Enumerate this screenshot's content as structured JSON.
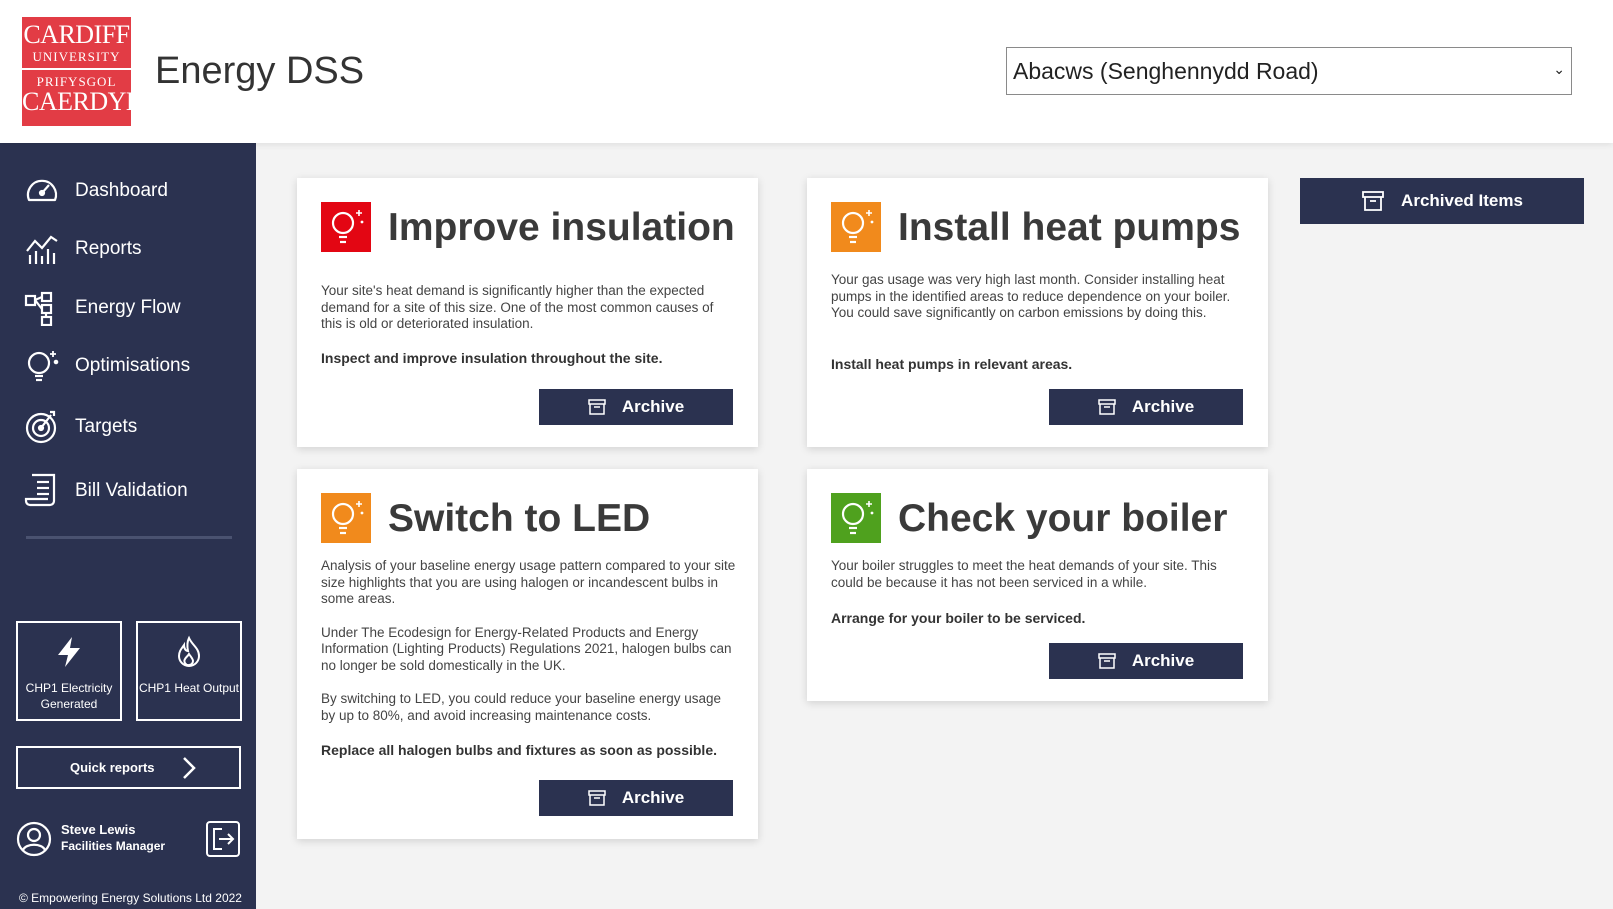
{
  "header": {
    "logo": {
      "line1": "CARDIFF",
      "line2": "UNIVERSITY",
      "line3": "PRIFYSGOL",
      "line4": "CAERDYD",
      "bg_color": "#e23c45"
    },
    "title": "Energy DSS",
    "site_select": {
      "value": "Abacws (Senghennydd Road)",
      "icon": "chevron-down-icon"
    }
  },
  "sidebar": {
    "bg_color": "#2b3250",
    "nav": [
      {
        "label": "Dashboard",
        "icon": "speedometer-icon"
      },
      {
        "label": "Reports",
        "icon": "chart-icon"
      },
      {
        "label": "Energy Flow",
        "icon": "flow-diagram-icon"
      },
      {
        "label": "Optimisations",
        "icon": "lightbulb-icon"
      },
      {
        "label": "Targets",
        "icon": "target-icon"
      },
      {
        "label": "Bill Validation",
        "icon": "receipt-icon"
      }
    ],
    "tiles": [
      {
        "label": "CHP1 Electricity Generated",
        "icon": "lightning-icon"
      },
      {
        "label": "CHP1 Heat Output",
        "icon": "flame-icon"
      }
    ],
    "quick_reports": {
      "label": "Quick reports",
      "icon": "chevron-right-icon"
    },
    "user": {
      "name": "Steve Lewis",
      "role": "Facilities Manager",
      "icon": "user-avatar-icon",
      "logout_icon": "logout-icon"
    },
    "copyright": "© Empowering Energy Solutions Ltd 2022"
  },
  "main": {
    "archived_items_label": "Archived Items",
    "cards": [
      {
        "title": "Improve insulation",
        "badge_color": "#e30613",
        "paragraphs": [
          "Your site's heat demand is significantly higher than the expected demand for a site of this size. One of the most common causes of this is old or deteriorated insulation."
        ],
        "action": "Inspect and improve insulation throughout the site.",
        "archive_label": "Archive"
      },
      {
        "title": "Install heat pumps",
        "badge_color": "#f18a1c",
        "paragraphs": [
          "Your gas usage was very high last month. Consider installing heat pumps in the identified areas to reduce dependence on your boiler. You could save significantly on carbon emissions by doing this."
        ],
        "action": "Install heat pumps in relevant areas.",
        "archive_label": "Archive"
      },
      {
        "title": "Switch to LED",
        "badge_color": "#f18a1c",
        "paragraphs": [
          "Analysis of your baseline energy usage pattern compared to your site size highlights that you are using halogen or incandescent bulbs in some areas.",
          "Under The Ecodesign for Energy-Related Products and Energy Information (Lighting Products) Regulations 2021, halogen bulbs can no longer be sold domestically in the UK.",
          "By switching to LED, you could reduce your baseline energy usage by up to 80%, and avoid increasing maintenance costs."
        ],
        "action": "Replace all halogen bulbs and fixtures as soon as possible.",
        "archive_label": "Archive"
      },
      {
        "title": "Check your boiler",
        "badge_color": "#4fa11e",
        "paragraphs": [
          "Your boiler struggles to meet the heat demands of your site. This could be because it has not been serviced in a while."
        ],
        "action": "Arrange for your boiler to be serviced.",
        "archive_label": "Archive"
      }
    ]
  }
}
